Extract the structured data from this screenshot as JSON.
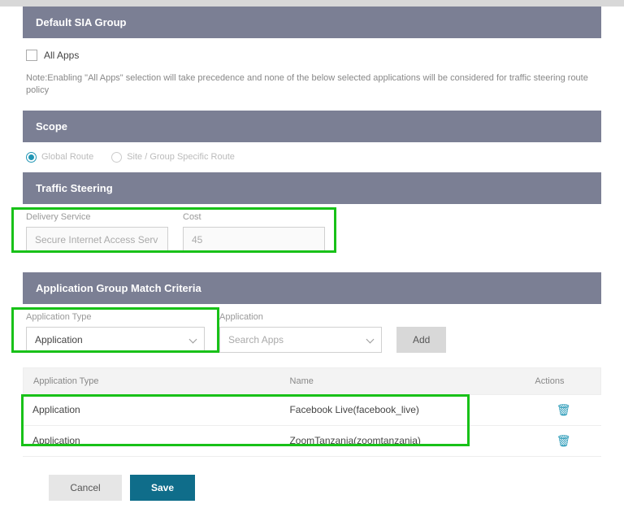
{
  "headers": {
    "default_sia": "Default SIA Group",
    "scope": "Scope",
    "traffic_steering": "Traffic Steering",
    "app_match": "Application Group Match Criteria"
  },
  "all_apps": {
    "label": "All Apps"
  },
  "note": "Note:Enabling \"All Apps\" selection will take precedence and none of the below selected applications will be considered for traffic steering route policy",
  "scope_options": {
    "global": "Global Route",
    "site": "Site / Group Specific Route"
  },
  "delivery": {
    "label": "Delivery Service",
    "value": "Secure Internet Access Serv",
    "cost_label": "Cost",
    "cost_value": "45"
  },
  "match": {
    "app_type_label": "Application Type",
    "app_type_value": "Application",
    "application_label": "Application",
    "application_placeholder": "Search Apps",
    "add_label": "Add"
  },
  "table": {
    "cols": {
      "type": "Application Type",
      "name": "Name",
      "actions": "Actions"
    },
    "rows": [
      {
        "type": "Application",
        "name": "Facebook Live(facebook_live)"
      },
      {
        "type": "Application",
        "name": "ZoomTanzania(zoomtanzania)"
      }
    ]
  },
  "footer": {
    "cancel": "Cancel",
    "save": "Save"
  }
}
